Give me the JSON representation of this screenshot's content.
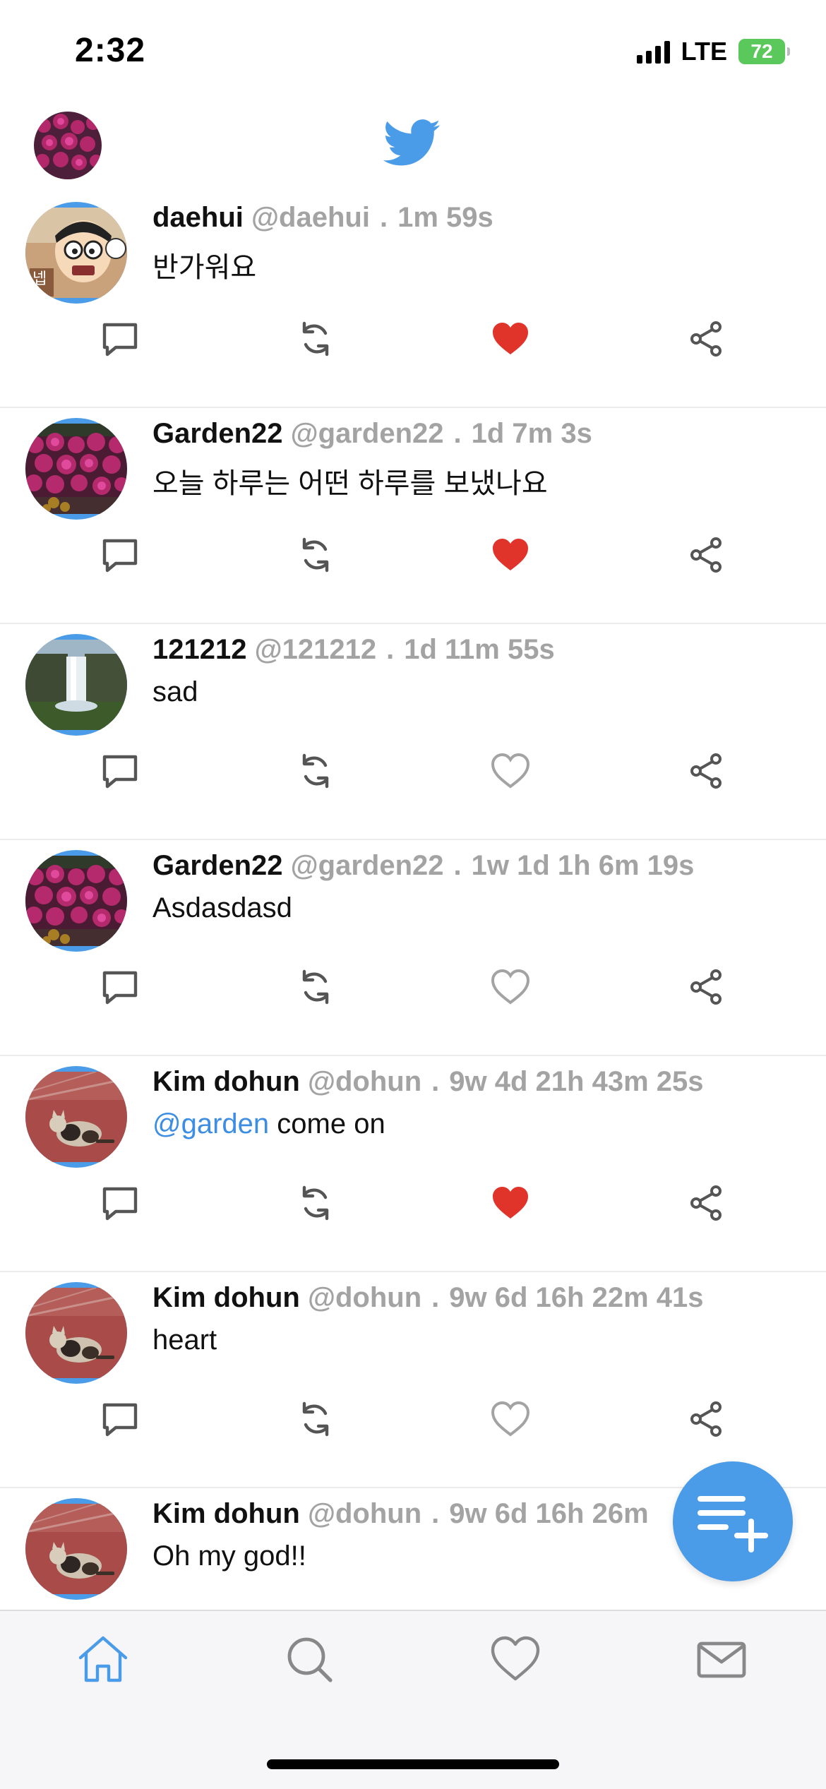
{
  "status_bar": {
    "time": "2:32",
    "network": "LTE",
    "battery": "72"
  },
  "header": {
    "logo": "twitter-bird-icon"
  },
  "tweets": [
    {
      "name": "daehui",
      "handle": "@daehui",
      "separator": ".",
      "ago": "1m 59s",
      "text": "반가워요",
      "liked": true,
      "avatar": "cartoon"
    },
    {
      "name": "Garden22",
      "handle": "@garden22",
      "separator": ".",
      "ago": "1d 7m 3s",
      "text": "오늘 하루는 어떤 하루를 보냈나요",
      "liked": true,
      "avatar": "flowers"
    },
    {
      "name": "121212",
      "handle": "@121212",
      "separator": ".",
      "ago": "1d 11m 55s",
      "text": "sad",
      "liked": false,
      "avatar": "waterfall"
    },
    {
      "name": "Garden22",
      "handle": "@garden22",
      "separator": ".",
      "ago": "1w 1d 1h 6m 19s",
      "text": "Asdasdasd",
      "liked": false,
      "avatar": "flowers"
    },
    {
      "name": "Kim dohun",
      "handle": "@dohun",
      "separator": ".",
      "ago": "9w 4d 21h 43m 25s",
      "mention": "@garden",
      "text": " come on",
      "liked": true,
      "avatar": "cat"
    },
    {
      "name": "Kim dohun",
      "handle": "@dohun",
      "separator": ".",
      "ago": "9w 6d 16h 22m 41s",
      "text": "heart",
      "liked": false,
      "avatar": "cat"
    },
    {
      "name": "Kim dohun",
      "handle": "@dohun",
      "separator": ".",
      "ago": "9w 6d 16h 26m",
      "text": "Oh my god!!",
      "liked": false,
      "avatar": "cat"
    }
  ],
  "fab": {
    "icon": "compose-list-add-icon"
  },
  "tab_bar": {
    "tabs": [
      {
        "icon": "home-icon",
        "active": true
      },
      {
        "icon": "search-icon",
        "active": false
      },
      {
        "icon": "heart-icon",
        "active": false
      },
      {
        "icon": "mail-icon",
        "active": false
      }
    ]
  },
  "colors": {
    "accent": "#4a9be8",
    "like": "#e0342a",
    "muted": "#a3a3a3",
    "icon": "#555555"
  }
}
